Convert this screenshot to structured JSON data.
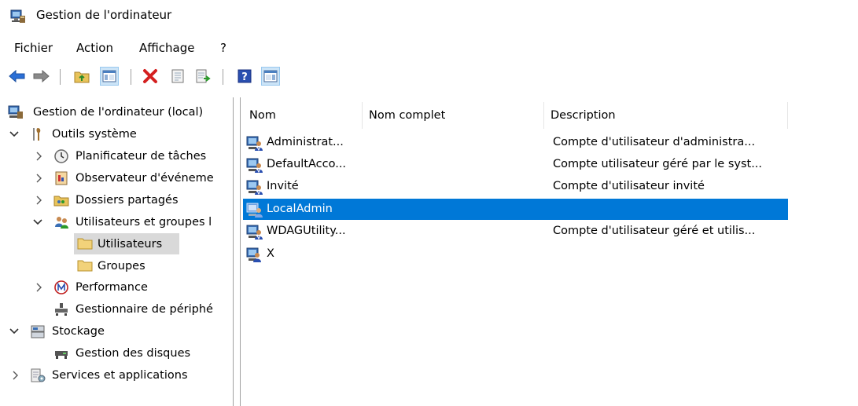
{
  "window": {
    "title": "Gestion de l'ordinateur"
  },
  "menu": [
    "Fichier",
    "Action",
    "Affichage",
    "?"
  ],
  "toolbar": {
    "buttons": [
      "back-icon",
      "forward-icon",
      "up-folder-icon",
      "show-hide-tree-icon",
      "delete-icon",
      "properties-icon",
      "export-list-icon",
      "help-icon",
      "show-hide-action-pane-icon"
    ]
  },
  "tree": {
    "root": "Gestion de l'ordinateur (local)",
    "items": [
      {
        "label": "Outils système"
      },
      {
        "label": "Planificateur de tâches"
      },
      {
        "label": "Observateur d'événeme"
      },
      {
        "label": "Dossiers partagés"
      },
      {
        "label": "Utilisateurs et groupes l"
      },
      {
        "label": "Utilisateurs"
      },
      {
        "label": "Groupes"
      },
      {
        "label": "Performance"
      },
      {
        "label": "Gestionnaire de périphé"
      },
      {
        "label": "Stockage"
      },
      {
        "label": "Gestion des disques"
      },
      {
        "label": "Services et applications"
      }
    ]
  },
  "list": {
    "columns": [
      "Nom",
      "Nom complet",
      "Description"
    ],
    "rows": [
      {
        "name": "Administrat...",
        "fullname": "",
        "description": "Compte d'utilisateur d'administra..."
      },
      {
        "name": "DefaultAcco...",
        "fullname": "",
        "description": "Compte utilisateur géré par le syst..."
      },
      {
        "name": "Invité",
        "fullname": "",
        "description": "Compte d'utilisateur invité"
      },
      {
        "name": "LocalAdmin",
        "fullname": "",
        "description": ""
      },
      {
        "name": "WDAGUtility...",
        "fullname": "",
        "description": "Compte d'utilisateur géré et utilis..."
      },
      {
        "name": "X",
        "fullname": "",
        "description": ""
      }
    ]
  },
  "colors": {
    "selection": "#0078d7",
    "tree_selection": "#d9d9d9"
  }
}
